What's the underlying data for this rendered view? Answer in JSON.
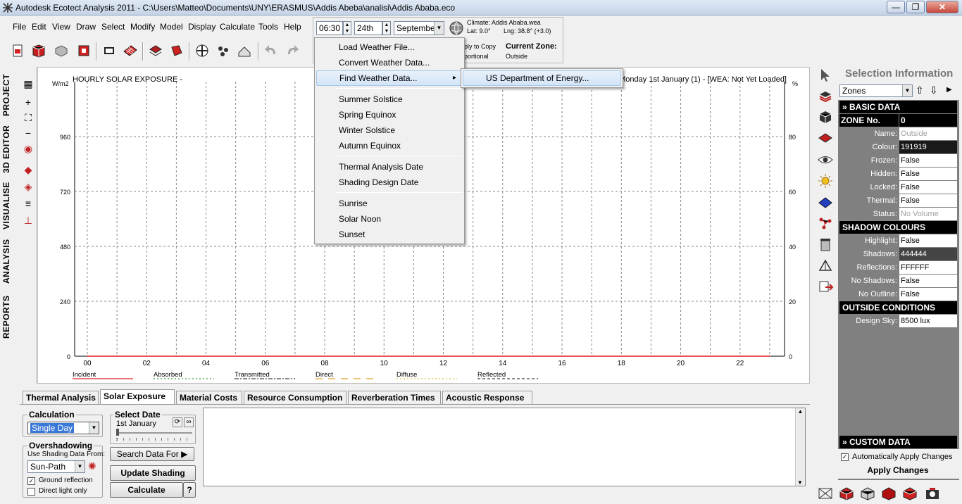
{
  "window": {
    "title": "Autodesk Ecotect Analysis 2011 - C:\\Users\\Matteo\\Documents\\UNY\\ERASMUS\\Addis Abeba\\analisi\\Addis Ababa.eco",
    "controls": {
      "minimize": "—",
      "maximize": "❐",
      "close": "✕"
    }
  },
  "menubar": [
    "File",
    "Edit",
    "View",
    "Draw",
    "Select",
    "Modify",
    "Model",
    "Display",
    "Calculate",
    "Tools",
    "Help"
  ],
  "datebar": {
    "time": "06:30",
    "day": "24th",
    "month": "September",
    "climate_label": "Climate:",
    "climate_file": "Addis Ababa.wea",
    "lat": "Lat: 9.0°",
    "lng": "Lng: 38.8° (+3.0)",
    "apply_copy": "ply to Copy",
    "proportional": "portional",
    "current_zone_label": "Current Zone:",
    "current_zone": "Outside"
  },
  "left_tabs": [
    "PROJECT",
    "3D EDITOR",
    "VISUALISE",
    "ANALYSIS",
    "REPORTS"
  ],
  "chart": {
    "title": "HOURLY SOLAR EXPOSURE -",
    "subtitle": "Monday 1st January (1) - [WEA: Not Yet Loaded]",
    "y_unit_left": "W/m2",
    "y_unit_right": "%"
  },
  "chart_data": {
    "type": "line",
    "title": "HOURLY SOLAR EXPOSURE -",
    "subtitle": "Monday 1st January (1) - [WEA: Not Yet Loaded]",
    "ylabel": "W/m2",
    "y2label": "%",
    "x_ticks": [
      "00",
      "02",
      "04",
      "06",
      "08",
      "10",
      "12",
      "14",
      "16",
      "18",
      "20",
      "22"
    ],
    "xlim": [
      0,
      23.5
    ],
    "y_ticks": [
      0,
      240,
      480,
      720,
      960
    ],
    "ylim": [
      0,
      1200
    ],
    "y2_ticks": [
      0,
      20,
      40,
      60,
      80
    ],
    "y2lim": [
      0,
      100
    ],
    "grid": true,
    "legend": [
      {
        "name": "Incident",
        "color": "#e02020",
        "dash": "solid"
      },
      {
        "name": "Absorbed",
        "color": "#3a9a3a",
        "dash": "dotted"
      },
      {
        "name": "Transmitted",
        "color": "#404040",
        "dash": "dashdot"
      },
      {
        "name": "Direct",
        "color": "#e0a020",
        "dash": "longdash"
      },
      {
        "name": "Diffuse",
        "color": "#e0c040",
        "dash": "dotted"
      },
      {
        "name": "Reflected",
        "color": "#404040",
        "dash": "dashed"
      }
    ],
    "series": [
      {
        "name": "Incident",
        "values": [
          0,
          0,
          0,
          0,
          0,
          0,
          0,
          0,
          0,
          0,
          0,
          0,
          0,
          0,
          0,
          0,
          0,
          0,
          0,
          0,
          0,
          0,
          0,
          0
        ]
      }
    ]
  },
  "weather_menu": {
    "items": [
      {
        "label": "Load Weather File...",
        "submenu": false
      },
      {
        "label": "Convert Weather Data...",
        "submenu": false
      },
      {
        "label": "Find Weather Data...",
        "submenu": true,
        "highlighted": true
      },
      {
        "sep": true
      },
      {
        "label": "Summer Solstice"
      },
      {
        "label": "Spring Equinox"
      },
      {
        "label": "Winter Solstice"
      },
      {
        "label": "Autumn Equinox"
      },
      {
        "sep": true
      },
      {
        "label": "Thermal Analysis Date"
      },
      {
        "label": "Shading Design Date"
      },
      {
        "sep": true
      },
      {
        "label": "Sunrise"
      },
      {
        "label": "Solar Noon"
      },
      {
        "label": "Sunset"
      }
    ],
    "submenu": {
      "label": "US Department of Energy..."
    },
    "arrow": "▸"
  },
  "bottom_tabs": [
    "Thermal Analysis",
    "Solar Exposure",
    "Material Costs",
    "Resource Consumption",
    "Reverberation Times",
    "Acoustic Response"
  ],
  "bottom_panel": {
    "calculation_label": "Calculation",
    "calculation_value": "Single Day",
    "select_date_label": "Select Date",
    "select_date_value": "1st January",
    "overshadowing_label": "Overshadowing",
    "use_shading_from": "Use Shading Data From:",
    "shading_source": "Sun-Path",
    "ground_reflection": "Ground reflection",
    "ground_reflection_checked": true,
    "direct_light_only": "Direct light only",
    "direct_light_only_checked": false,
    "search_data_for": "Search Data For",
    "update_shading": "Update Shading",
    "calculate": "Calculate",
    "help": "?"
  },
  "selection": {
    "header": "Selection Information",
    "type": "Zones",
    "basic_data": "BASIC DATA",
    "zone_no_label": "ZONE No.",
    "zone_no": "0",
    "basic": [
      {
        "label": "Name:",
        "value": "Outside",
        "style": "muted"
      },
      {
        "label": "Colour:",
        "value": "191919",
        "style": "dark"
      },
      {
        "label": "Frozen:",
        "value": "False"
      },
      {
        "label": "Hidden:",
        "value": "False"
      },
      {
        "label": "Locked:",
        "value": "False"
      },
      {
        "label": "Thermal:",
        "value": "False"
      },
      {
        "label": "Status:",
        "value": "No Volume",
        "style": "muted"
      }
    ],
    "shadow_colours": "SHADOW COLOURS",
    "shadow": [
      {
        "label": "Highlight:",
        "value": "False"
      },
      {
        "label": "Shadows:",
        "value": "444444",
        "style": "darkgrey"
      },
      {
        "label": "Reflections:",
        "value": "FFFFFF"
      },
      {
        "label": "No Shadows:",
        "value": "False"
      },
      {
        "label": "No Outline:",
        "value": "False"
      }
    ],
    "outside_conditions": "OUTSIDE CONDITIONS",
    "outside": [
      {
        "label": "Design Sky:",
        "value": "8500 lux"
      }
    ],
    "custom_data": "CUSTOM DATA",
    "auto_apply": "Automatically Apply Changes",
    "auto_apply_checked": true,
    "apply_changes": "Apply Changes"
  }
}
